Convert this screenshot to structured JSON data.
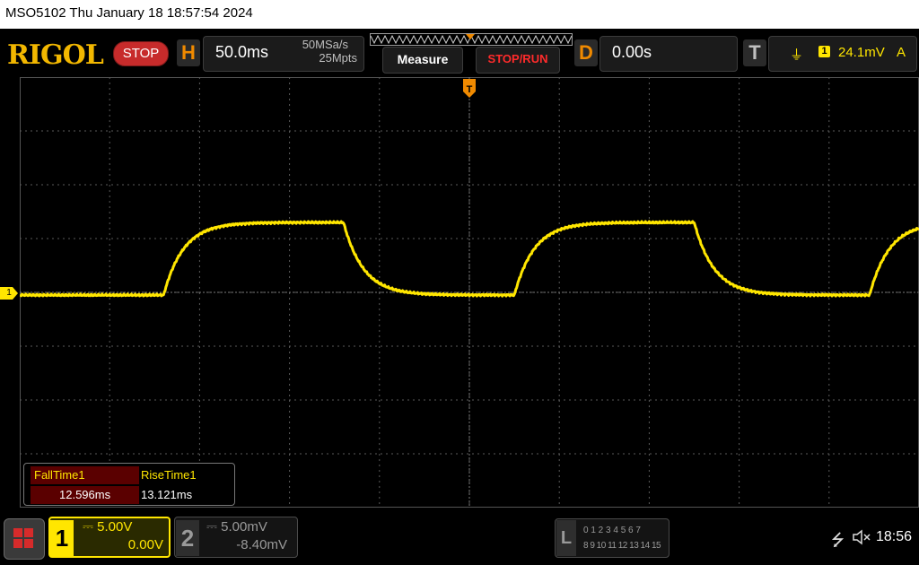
{
  "title_bar": {
    "text": "MSO5102  Thu January 18 18:57:54 2024"
  },
  "brand": {
    "logo_text": "RIGOL",
    "run_state": "STOP"
  },
  "horizontal": {
    "letter": "H",
    "time_per_div": "50.0ms",
    "sample_rate": "50MSa/s",
    "memory_depth": "25Mpts"
  },
  "buttons": {
    "measure": "Measure",
    "stop_run": "STOP/RUN"
  },
  "delay": {
    "letter": "D",
    "value": "0.00s"
  },
  "trigger": {
    "letter": "T",
    "edge_symbol": "⏚",
    "source": "1",
    "level": "24.1mV",
    "coupling": "A",
    "marker_label": "T"
  },
  "ch1_marker": "1",
  "measurements": {
    "fall": {
      "label": "FallTime1",
      "value": "12.596ms"
    },
    "rise": {
      "label": "RiseTime1",
      "value": "13.121ms"
    }
  },
  "channels": [
    {
      "number": "1",
      "scale": "5.00V",
      "offset": "0.00V",
      "color": "#ffe600",
      "active": true
    },
    {
      "number": "2",
      "scale": "5.00mV",
      "offset": "-8.40mV",
      "color": "#9a9a9a",
      "active": false
    }
  ],
  "logic_analyzer": {
    "letter": "L",
    "row1": "0 1 2 3  4 5 6 7",
    "row2": "8 9 10 11 12 13 14 15"
  },
  "status": {
    "usb_icon": "usb-icon",
    "speaker_icon": "speaker-muted-icon",
    "clock": "18:56"
  },
  "colors": {
    "trace": "#ffe600",
    "accent_orange": "#f08a00",
    "stop_red": "#c72b2b"
  },
  "waveform": {
    "type": "square-like with exponential rise/fall",
    "low_level_divs": -0.05,
    "high_level_divs": 1.3,
    "transitions": [
      {
        "edge": "rise",
        "time_divs": 1.6
      },
      {
        "edge": "fall",
        "time_divs": 3.6
      },
      {
        "edge": "rise",
        "time_divs": 5.5
      },
      {
        "edge": "fall",
        "time_divs": 7.5
      },
      {
        "edge": "rise",
        "time_divs": 9.45
      }
    ],
    "initial_state": "low"
  }
}
